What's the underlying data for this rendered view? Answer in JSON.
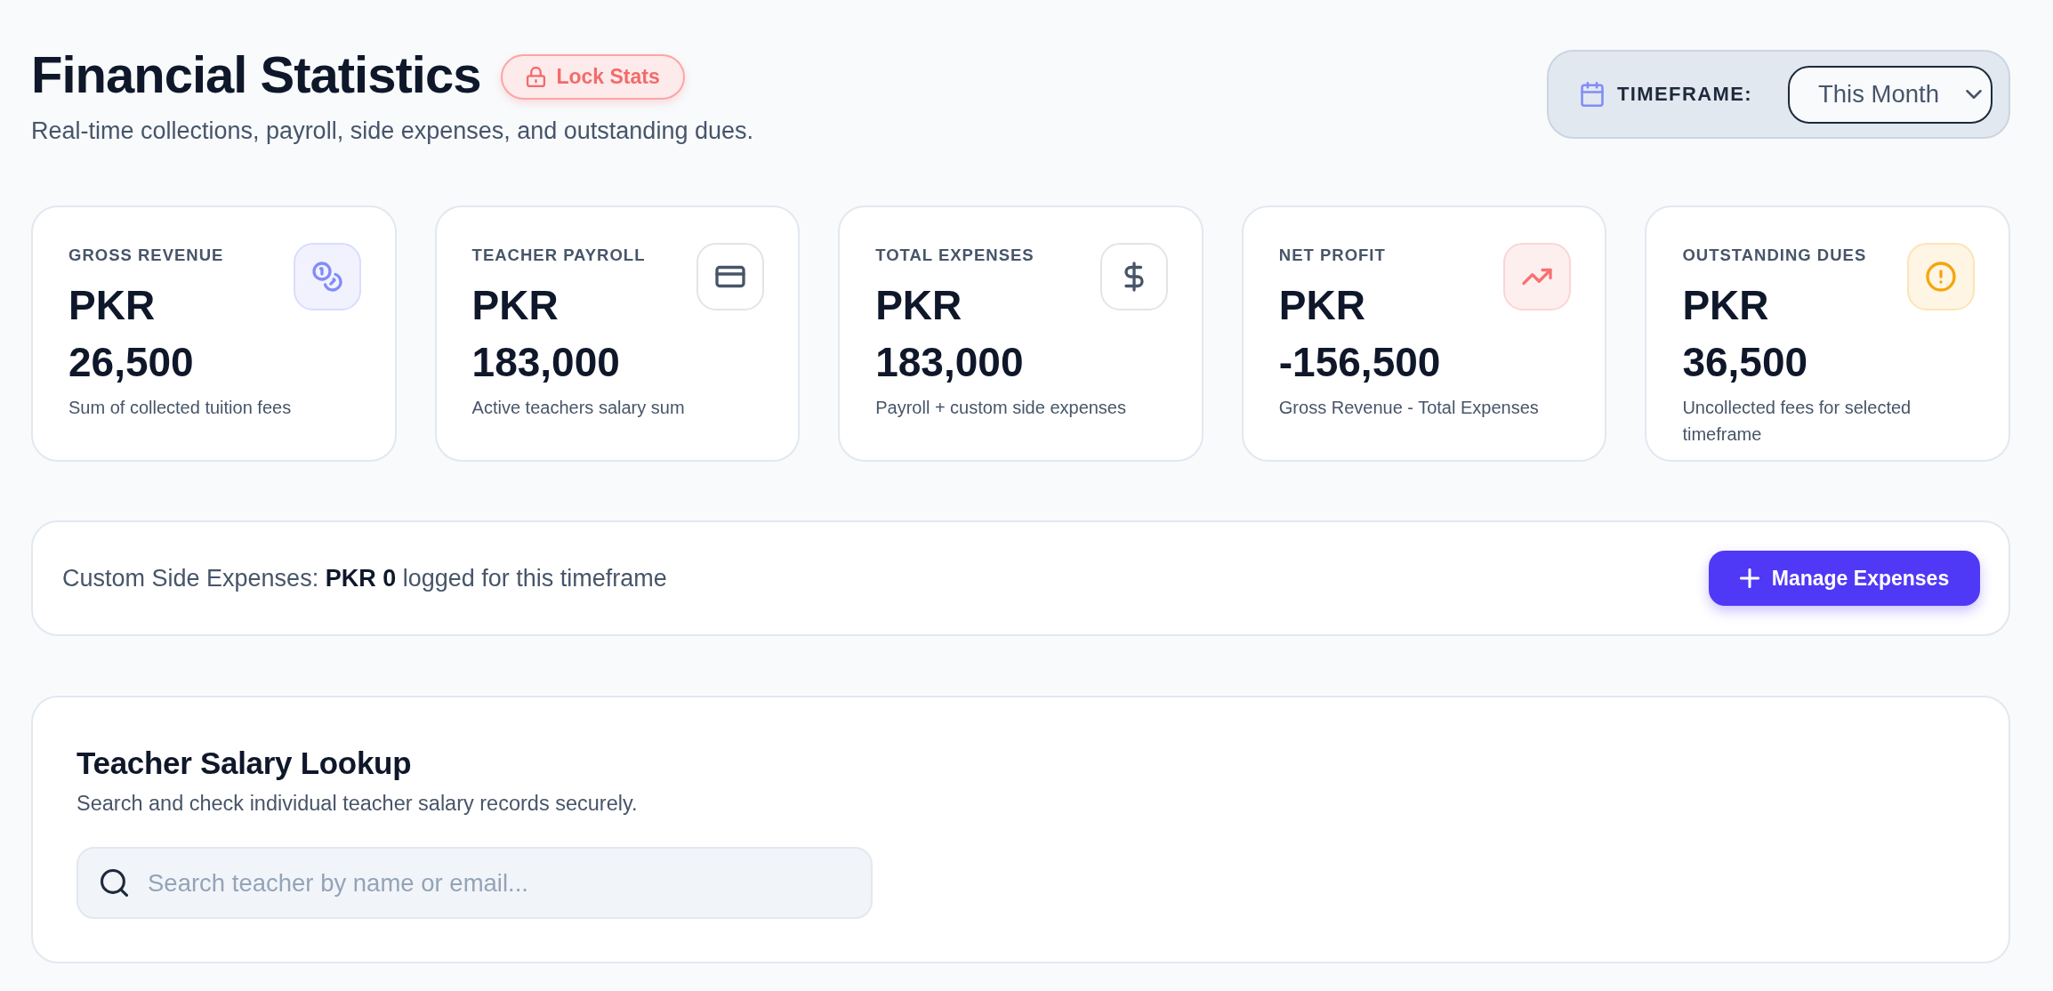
{
  "header": {
    "title": "Financial Statistics",
    "lock_button": "Lock Stats",
    "subtitle": "Real-time collections, payroll, side expenses, and outstanding dues."
  },
  "timeframe": {
    "label": "TIMEFRAME:",
    "value": "This Month"
  },
  "cards": [
    {
      "kind": "revenue",
      "label": "GROSS REVENUE",
      "value": "PKR 26,500",
      "description": "Sum of collected tuition fees",
      "color": "#818cf8"
    },
    {
      "kind": "payroll",
      "label": "TEACHER PAYROLL",
      "value": "PKR 183,000",
      "description": "Active teachers salary sum",
      "color": "#475569"
    },
    {
      "kind": "expenses",
      "label": "TOTAL EXPENSES",
      "value": "PKR 183,000",
      "description": "Payroll + custom side expenses",
      "color": "#475569"
    },
    {
      "kind": "profit",
      "label": "NET PROFIT",
      "value": "PKR -156,500",
      "description": "Gross Revenue - Total Expenses",
      "color": "#f87171"
    },
    {
      "kind": "dues",
      "label": "OUTSTANDING DUES",
      "value": "PKR 36,500",
      "description": "Uncollected fees for selected timeframe",
      "color": "#f5a50b"
    }
  ],
  "side_expenses": {
    "summary": "Custom Side Expenses: **PKR 0** logged for this timeframe",
    "button": "Manage Expenses"
  },
  "salary_lookup": {
    "title": "Teacher Salary Lookup",
    "subtitle": "Search and check individual teacher salary records securely.",
    "search": {
      "placeholder": "Search teacher by name or email..."
    }
  }
}
